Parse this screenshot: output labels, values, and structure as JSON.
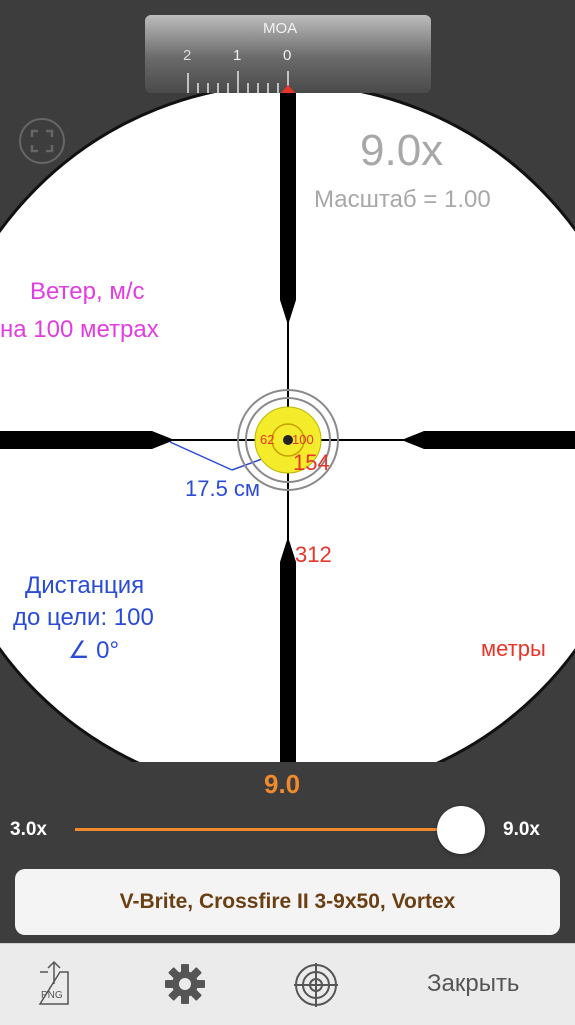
{
  "scope_view": {
    "magnification_label": "9.0x",
    "scale_label": "Масштаб = 1.00",
    "wind_line1": "Ветер, м/с",
    "wind_line2": "на 100 метрах",
    "distance_line1": "Дистанция",
    "distance_line2": "до цели: 100",
    "angle_label": "∠ 0°",
    "units_label": "метры",
    "width_measure": "17.5 см",
    "target_left_value": "62",
    "target_right_value": "100",
    "target_below_value": "154",
    "post_value": "312",
    "colors": {
      "magenta": "#e23de3",
      "blue": "#2a4bd8",
      "red": "#e8352a",
      "grey_text": "#a8a8a8",
      "target_yellow": "#f4ec2a"
    }
  },
  "moa_scale": {
    "title": "MOA",
    "ticks": [
      "2",
      "1",
      "0"
    ],
    "marker_color": "#e8352a"
  },
  "zoom": {
    "current_value": "9.0",
    "min_label": "3.0x",
    "max_label": "9.0x",
    "slider_fraction": 1.0,
    "accent": "#f08a2c"
  },
  "scope_name": "V-Brite, Crossfire II 3-9x50, Vortex",
  "toolbar": {
    "png_label": "PNG",
    "close_label": "Закрыть",
    "icons": [
      "export-png-icon",
      "gear-icon",
      "target-icon"
    ]
  }
}
